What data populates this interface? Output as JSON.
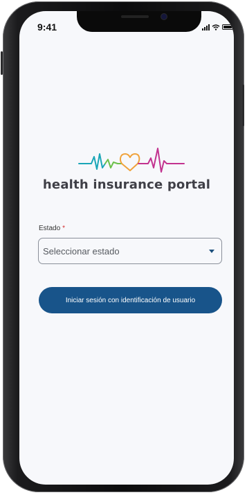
{
  "status_bar": {
    "time": "9:41"
  },
  "brand": {
    "name": "health insurance portal"
  },
  "form": {
    "state_label": "Estado",
    "required_mark": "*",
    "state_placeholder": "Seleccionar estado"
  },
  "actions": {
    "login_label": "Iniciar sesión con identificación de usuario"
  },
  "colors": {
    "primary": "#18548a",
    "required": "#d32f2f",
    "logo_teal": "#1aa6b7",
    "logo_green": "#6cc04a",
    "logo_orange": "#f0a23a",
    "logo_magenta": "#c2338f"
  },
  "icons": [
    "signal-icon",
    "wifi-icon",
    "battery-icon",
    "heartbeat-logo-icon",
    "chevron-down-icon"
  ]
}
